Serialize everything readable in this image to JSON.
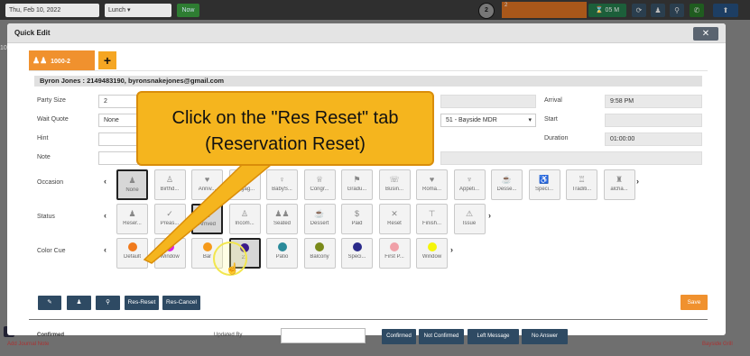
{
  "topbar": {
    "date": "Thu, Feb 10, 2022",
    "meal": "Lunch",
    "now_label": "Now",
    "counter": "2",
    "orange_value": "2",
    "timer": "05 M"
  },
  "background": {
    "side_text": "10",
    "bottom_left": "Add Journal Note",
    "bottom_right": "Bayside Grill"
  },
  "modal": {
    "title": "Quick Edit",
    "close": "✕",
    "tab_label": "1000-2",
    "add_tab": "+",
    "guest_header": "Byron Jones : 2149483190, byronsnakejones@gmail.com"
  },
  "fields": {
    "party_size_label": "Party Size",
    "party_size": "2",
    "wait_quote_label": "Wait Quote",
    "wait_quote": "None",
    "hint_label": "Hint",
    "note_label": "Note",
    "section": "51 - Bayside MDR",
    "arrival_label": "Arrival",
    "arrival": "9:58 PM",
    "start_label": "Start",
    "duration_label": "Duration",
    "duration": "01:00:00"
  },
  "occasion": {
    "label": "Occasion",
    "items": [
      {
        "label": "None",
        "icon": "♟",
        "selected": true
      },
      {
        "label": "Birthd...",
        "icon": "♙"
      },
      {
        "label": "Anniv...",
        "icon": "♥"
      },
      {
        "label": "Engag...",
        "icon": "◇"
      },
      {
        "label": "BabyS...",
        "icon": "♀"
      },
      {
        "label": "Congr...",
        "icon": "♕"
      },
      {
        "label": "Gradu...",
        "icon": "⚑"
      },
      {
        "label": "Busin...",
        "icon": "☏"
      },
      {
        "label": "Roma...",
        "icon": "♥"
      },
      {
        "label": "Appeti...",
        "icon": "♆"
      },
      {
        "label": "Desse...",
        "icon": "☕"
      },
      {
        "label": "Speci...",
        "icon": "♿"
      },
      {
        "label": "Traditi...",
        "icon": "♖"
      },
      {
        "label": "alcha...",
        "icon": "♜"
      }
    ]
  },
  "status": {
    "label": "Status",
    "items": [
      {
        "label": "Reser...",
        "icon": "♟"
      },
      {
        "label": "Preas...",
        "icon": "✓"
      },
      {
        "label": "Arrived",
        "icon": "♟",
        "selected": true
      },
      {
        "label": "Incom...",
        "icon": "♙"
      },
      {
        "label": "Seated",
        "icon": "♟♟"
      },
      {
        "label": "Dessert",
        "icon": "☕"
      },
      {
        "label": "Paid",
        "icon": "$"
      },
      {
        "label": "Reset",
        "icon": "✕"
      },
      {
        "label": "Finish...",
        "icon": "⊤"
      },
      {
        "label": "Issue",
        "icon": "⚠"
      }
    ]
  },
  "color_cue": {
    "label": "Color Cue",
    "items": [
      {
        "label": "Default",
        "color": "#f07a1c"
      },
      {
        "label": "Window",
        "color": "#e020e0"
      },
      {
        "label": "Bar",
        "color": "#f59a1a"
      },
      {
        "label": "21",
        "color": "#3a1a8a",
        "selected": true
      },
      {
        "label": "Patio",
        "color": "#2a8a9a"
      },
      {
        "label": "Balcony",
        "color": "#7a8a1a"
      },
      {
        "label": "Speci...",
        "color": "#2a2a8a"
      },
      {
        "label": "First P...",
        "color": "#f0a0a8"
      },
      {
        "label": "Window",
        "color": "#f5f50a"
      }
    ]
  },
  "actions": {
    "res_reset": "Res-Reset",
    "res_cancel": "Res-Cancel",
    "save": "Save"
  },
  "footer": {
    "confirmed": "Confirmed",
    "updated_by": "Updated By",
    "btn_confirmed": "Confirmed",
    "btn_not_confirmed": "Not Confirmed",
    "btn_left_message": "Left Message",
    "btn_no_answer": "No Answer"
  },
  "callout": {
    "line1": "Click on the \"Res Reset\" tab",
    "line2": "(Reservation Reset)"
  },
  "colors": {
    "accent_orange": "#f0912e",
    "navy_button": "#2e4a63",
    "callout_yellow": "#f5b51e"
  }
}
